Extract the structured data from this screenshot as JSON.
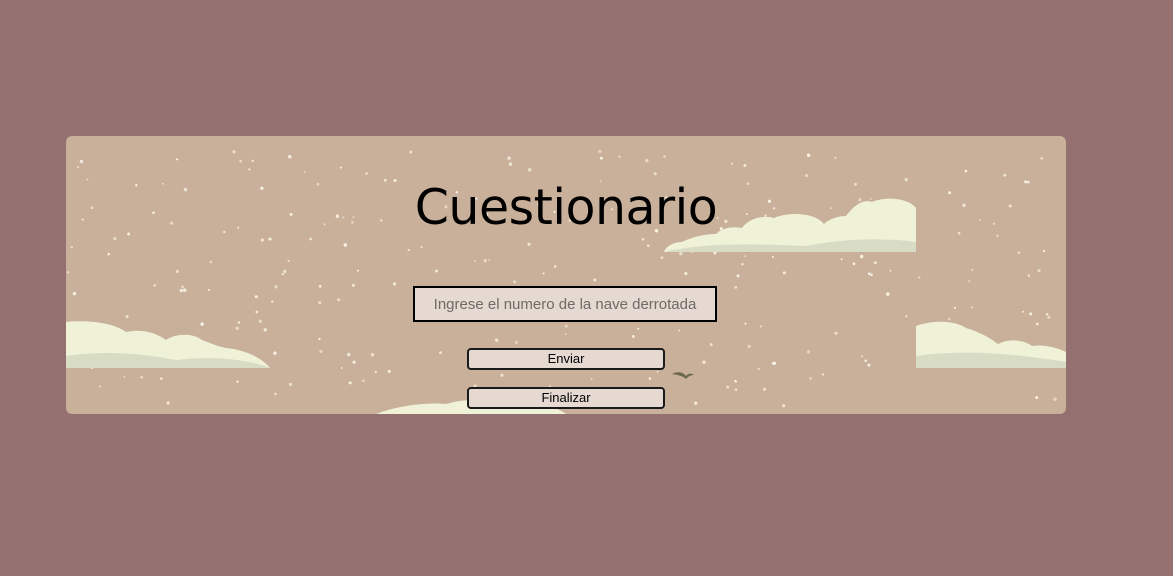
{
  "page": {
    "background_color": "#947070"
  },
  "card": {
    "background_color": "#c8b09a",
    "title": "Cuestionario",
    "answer_input": {
      "placeholder": "Ingrese el numero de la nave derrotada",
      "value": ""
    },
    "send_button": {
      "label": "Enviar"
    },
    "finish_button": {
      "label": "Finalizar"
    }
  },
  "scene": {
    "cloud_color": "#f0f2d8",
    "cloud_shadow_color": "#d8dcc4",
    "star_color": "#fbf4e6",
    "icons": [
      "clouds-icon",
      "stars-icon",
      "bird-icon"
    ]
  }
}
